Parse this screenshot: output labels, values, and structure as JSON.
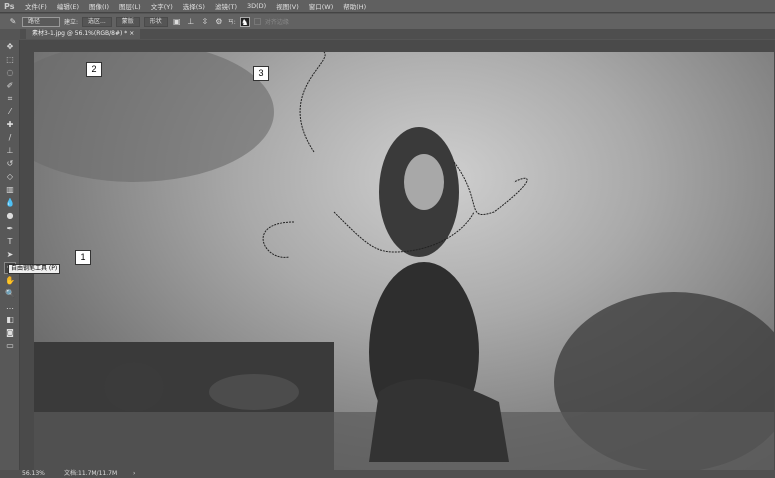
{
  "app": {
    "logo": "Ps"
  },
  "menu": [
    "文件(F)",
    "编辑(E)",
    "图像(I)",
    "图层(L)",
    "文字(Y)",
    "选择(S)",
    "滤镜(T)",
    "3D(D)",
    "视图(V)",
    "窗口(W)",
    "帮助(H)"
  ],
  "options": {
    "mode": "路径",
    "make_label": "建立:",
    "selection_btn": "选区...",
    "mask_btn": "蒙版",
    "shape_btn": "形状",
    "magnetic_label": "对齐边缘",
    "rubber_label": "ㄢ:"
  },
  "document_tab": {
    "title": "素材3-1.jpg @ 56.1%(RGB/8#) *",
    "close": "×"
  },
  "tooltip": "自由钢笔工具 (P)",
  "callouts": [
    "1",
    "2",
    "3"
  ],
  "status": {
    "zoom": "56.13%",
    "doc": "文档:11.7M/11.7M",
    "arrow": "›"
  }
}
